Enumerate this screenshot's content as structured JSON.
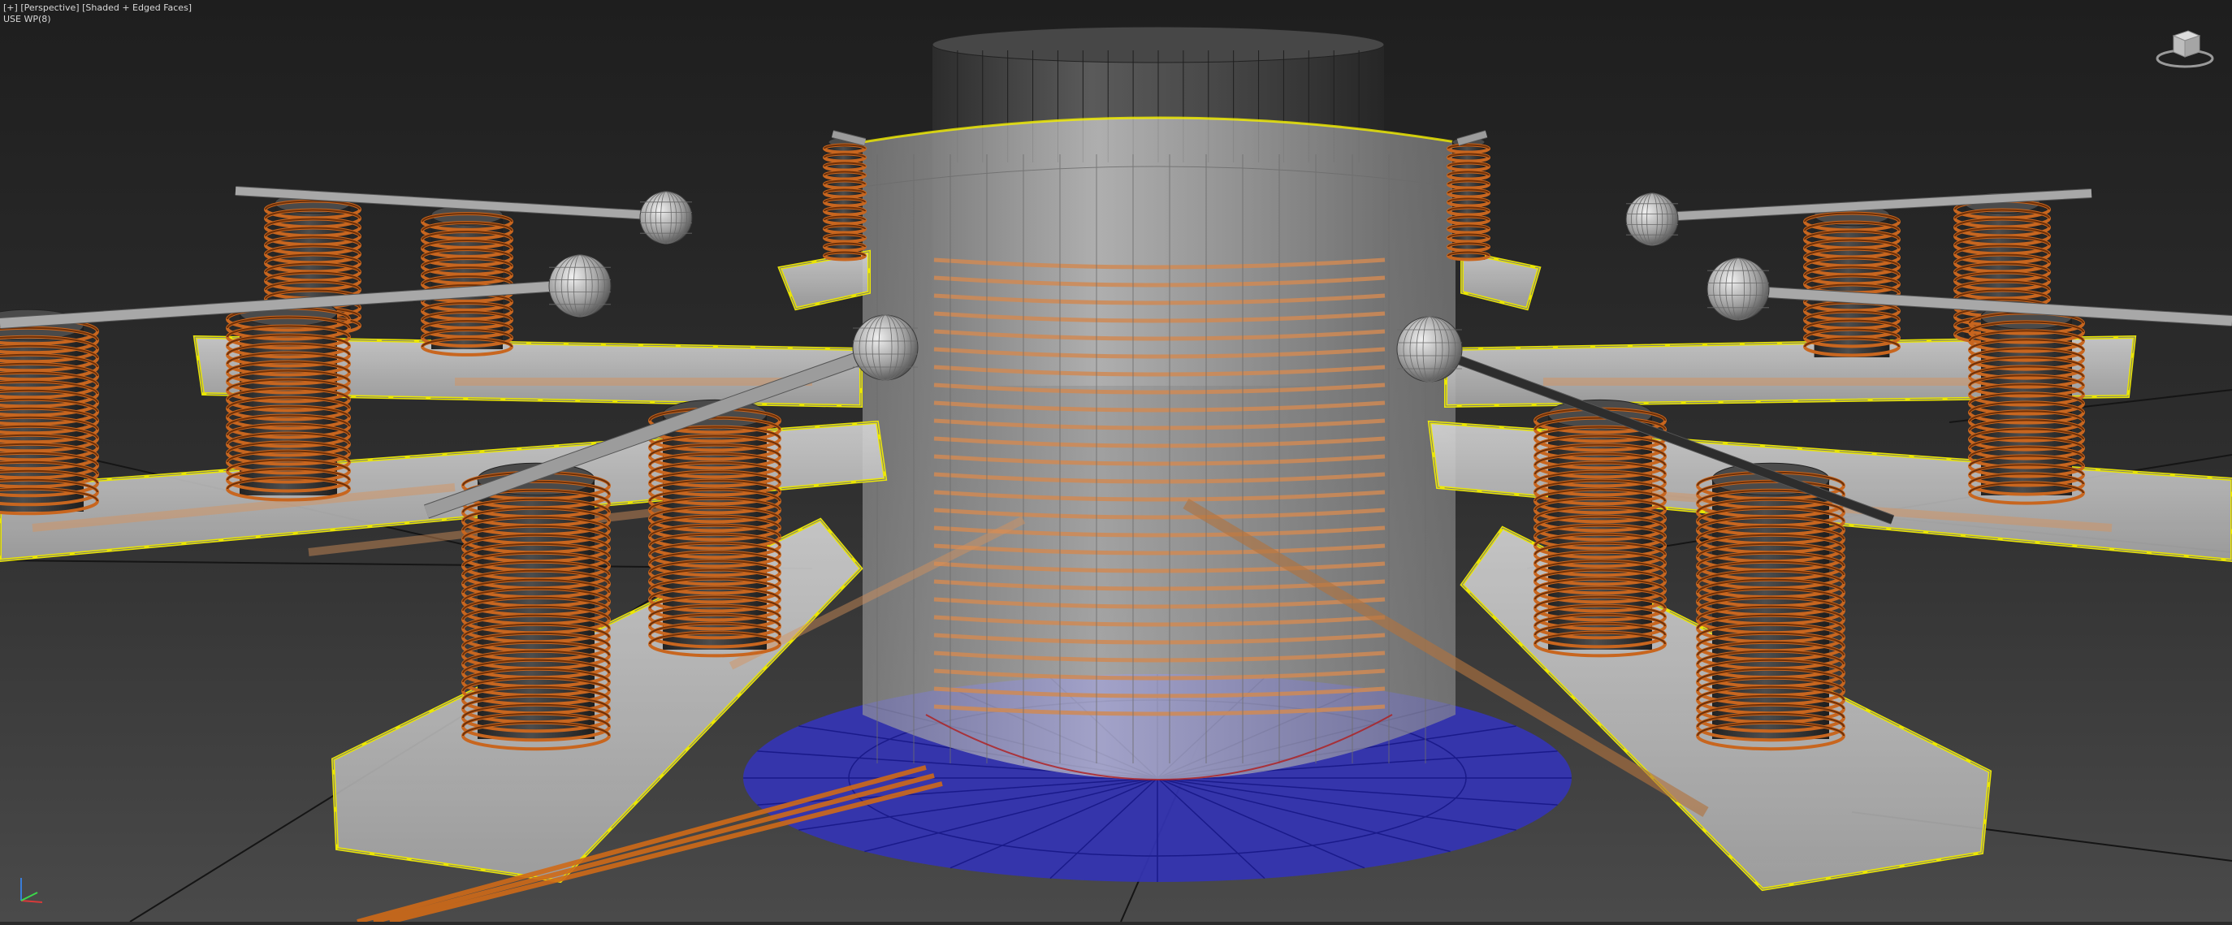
{
  "viewport": {
    "menu_labels": [
      "[+]",
      "[Perspective]",
      "[Shaded + Edged Faces]"
    ],
    "workplane_label": "USE WP(8)"
  },
  "colors": {
    "background_top": "#1f1f1f",
    "background_bottom": "#4a4a4a",
    "grid": "#151515",
    "selection_outline": "#f5f000",
    "copper": "#c8661f",
    "copper_dark": "#6e3008",
    "core_dark": "#3f3f3f",
    "glass": "#c9c9c9",
    "base_disc": "#3a3ab8",
    "wire": "#e07a20"
  },
  "icons": [
    "viewcube-icon",
    "axis-tripod-icon"
  ],
  "scene": {
    "coil_count": 12,
    "sphere_count": 6,
    "arm_count": 8
  }
}
